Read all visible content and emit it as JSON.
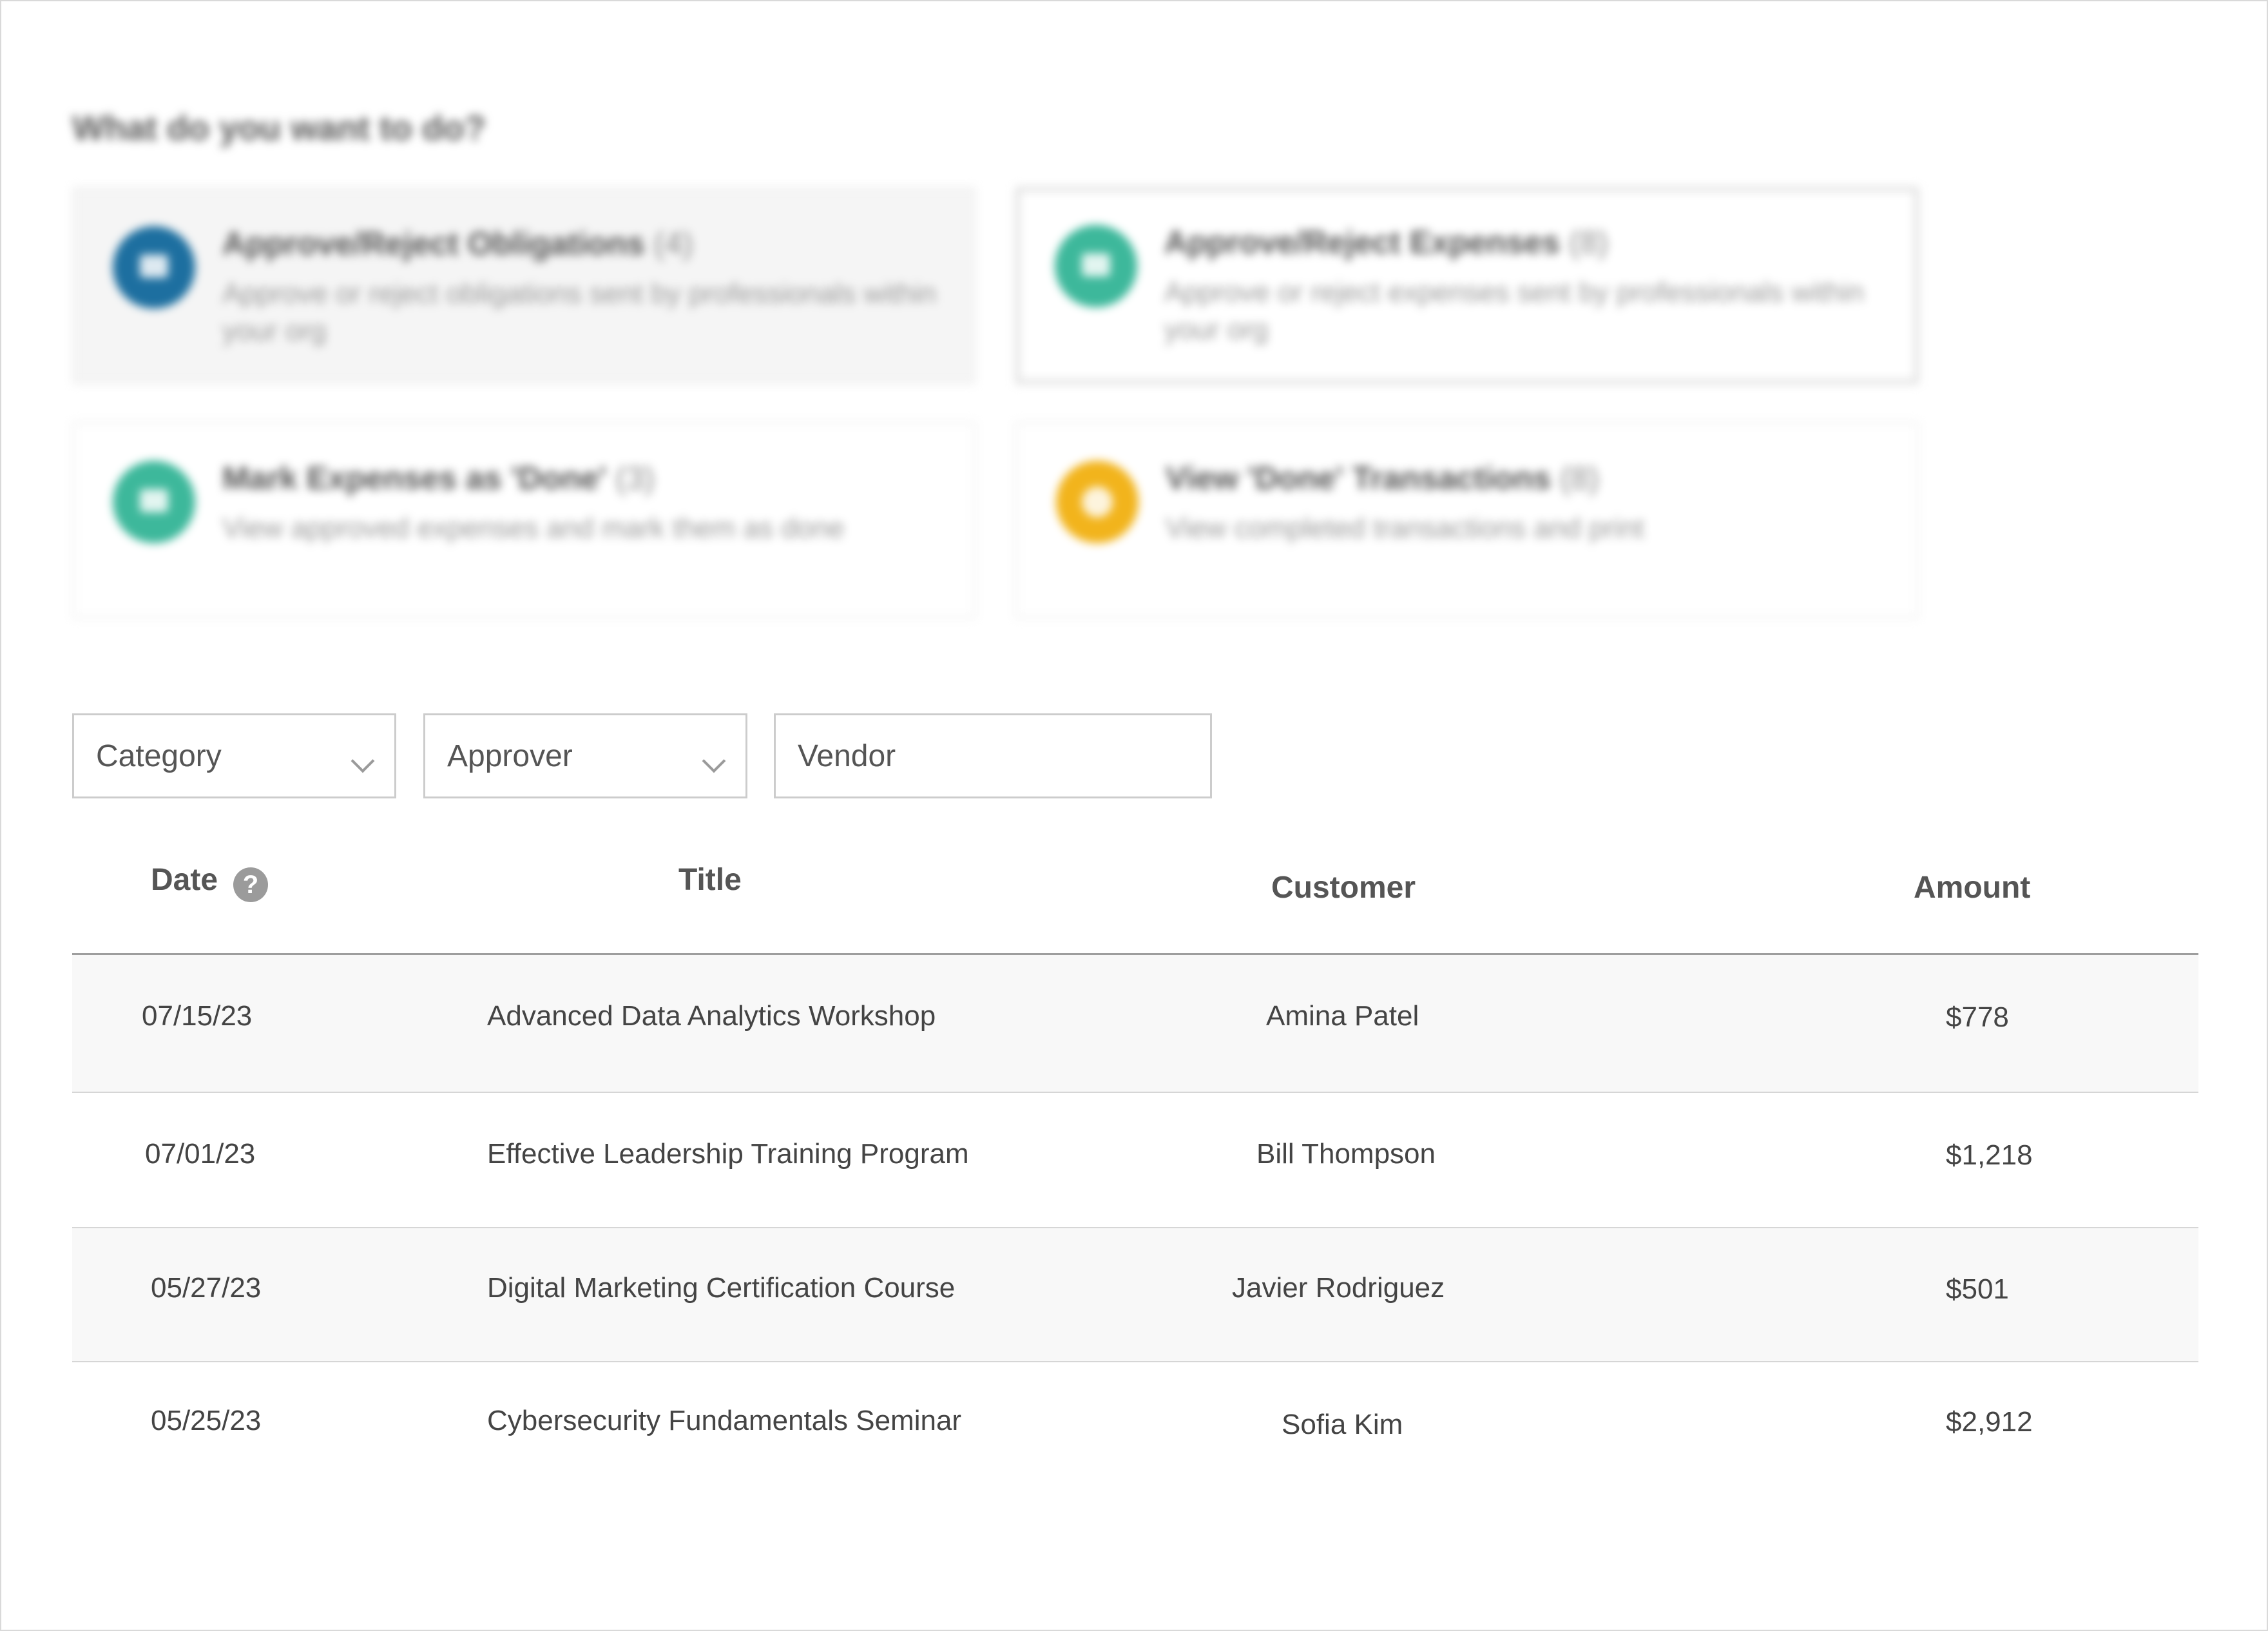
{
  "prompt": "What do you want to do?",
  "actions": [
    {
      "title": "Approve/Reject Obligations",
      "count": "(4)",
      "description": "Approve or reject obligations sent by professionals within your org",
      "icon": "document-icon",
      "color": "#1d6fa0"
    },
    {
      "title": "Approve/Reject Expenses",
      "count": "(8)",
      "description": "Approve or reject expenses sent by professionals within your org",
      "icon": "money-icon",
      "color": "#3db89b"
    },
    {
      "title": "Mark Expenses as 'Done'",
      "count": "(3)",
      "description": "View approved expenses and mark them as done",
      "icon": "money-icon",
      "color": "#3db89b"
    },
    {
      "title": "View 'Done' Transactions",
      "count": "(8)",
      "description": "View completed transactions and print",
      "icon": "checkmark-icon",
      "color": "#f2b41c"
    }
  ],
  "filters": {
    "category": "Category",
    "approver": "Approver",
    "vendor": "Vendor"
  },
  "table": {
    "headers": {
      "date": "Date",
      "title": "Title",
      "customer": "Customer",
      "amount": "Amount"
    },
    "help_glyph": "?",
    "rows": [
      {
        "date": "07/15/23",
        "title": "Advanced Data Analytics Workshop",
        "customer": "Amina Patel",
        "amount": "$778"
      },
      {
        "date": "07/01/23",
        "title": "Effective Leadership Training Program",
        "customer": "Bill Thompson",
        "amount": "$1,218"
      },
      {
        "date": "05/27/23",
        "title": "Digital Marketing Certification Course",
        "customer": "Javier Rodriguez",
        "amount": "$501"
      },
      {
        "date": "05/25/23",
        "title": "Cybersecurity Fundamentals Seminar",
        "customer": "Sofia Kim",
        "amount": "$2,912"
      }
    ]
  }
}
